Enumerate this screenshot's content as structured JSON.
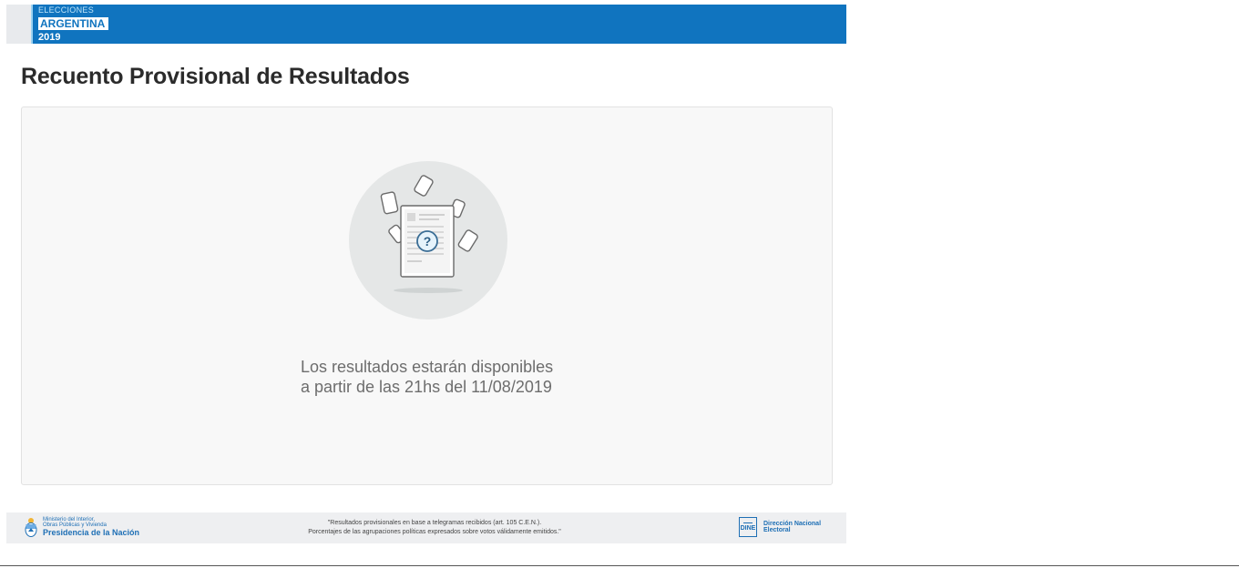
{
  "header": {
    "logo_line1": "ELECCIONES",
    "logo_line2": "ARGENTINA",
    "logo_line3": "2019"
  },
  "page_title": "Recuento Provisional de Resultados",
  "results": {
    "illustration_icon": "ballot-question-icon",
    "message_line1": "Los resultados estarán disponibles",
    "message_line2": "a partir de las 21hs del 11/08/2019"
  },
  "footer": {
    "ministry_line1": "Ministerio del Interior,",
    "ministry_line2": "Obras Públicas y Vivienda",
    "ministry_line3": "Presidencia de la Nación",
    "disclaimer_line1": "\"Resultados provisionales en base a telegramas recibidos (art. 105 C.E.N.).",
    "disclaimer_line2": "Porcentajes de las agrupaciones políticas expresados sobre votos válidamente emitidos.\"",
    "dine_badge": "DINE",
    "dine_line1": "Dirección Nacional",
    "dine_line2": "Electoral"
  },
  "colors": {
    "brand_blue": "#1074bf",
    "title_text": "#2b2b2b",
    "card_background": "#f8f8f8",
    "footer_background": "#eeeff1"
  }
}
